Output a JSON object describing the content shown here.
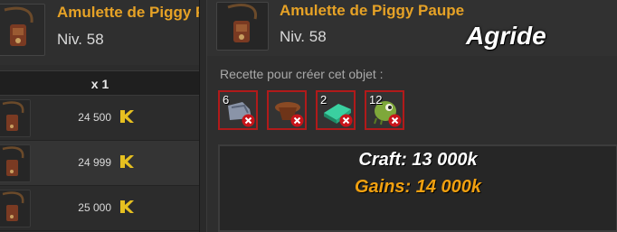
{
  "left_panel": {
    "item_title": "Amulette de Piggy P",
    "level": "Niv. 58",
    "quantity_label": "x 1",
    "rows": [
      {
        "price": "24 500"
      },
      {
        "price": "24 999"
      },
      {
        "price": "25 000"
      }
    ],
    "currency_icon": "kama-icon"
  },
  "right_panel": {
    "item_title": "Amulette de Piggy Paupe",
    "level": "Niv. 58",
    "overlay_name": "Agride",
    "recipe_label": "Recette pour créer cet objet :",
    "ingredients": [
      {
        "count": "6",
        "icon": "grey-boot-icon"
      },
      {
        "count": "",
        "icon": "brown-hat-icon"
      },
      {
        "count": "2",
        "icon": "green-gem-icon"
      },
      {
        "count": "12",
        "icon": "green-creature-icon"
      }
    ],
    "craft_text": "Craft: 13 000k",
    "gains_text": "Gains: 14 000k"
  },
  "colors": {
    "title": "#e6a226",
    "missing_border": "#b11a1a",
    "gains": "#f0a010"
  }
}
